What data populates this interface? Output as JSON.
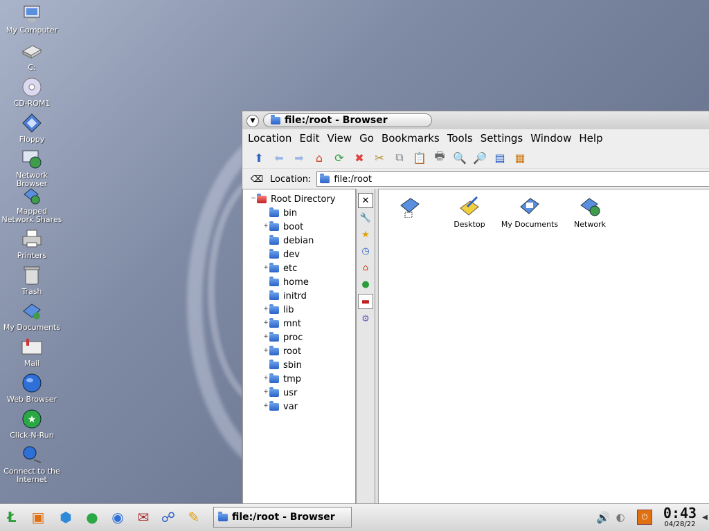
{
  "desktop": {
    "icons": [
      {
        "label": "My Computer",
        "icon": "computer-icon"
      },
      {
        "label": "C:",
        "icon": "drive-icon"
      },
      {
        "label": "CD-ROM1",
        "icon": "cdrom-icon"
      },
      {
        "label": "Floppy",
        "icon": "floppy-icon"
      },
      {
        "label": "Network Browser",
        "icon": "network-browser-icon"
      },
      {
        "label": "Mapped Network Shares",
        "icon": "network-shares-icon"
      },
      {
        "label": "Printers",
        "icon": "printer-icon"
      },
      {
        "label": "Trash",
        "icon": "trash-icon"
      },
      {
        "label": "My Documents",
        "icon": "documents-icon"
      },
      {
        "label": "Mail",
        "icon": "mail-icon"
      },
      {
        "label": "Web Browser",
        "icon": "globe-icon"
      },
      {
        "label": "Click-N-Run",
        "icon": "runner-icon"
      },
      {
        "label": "Connect to the Internet",
        "icon": "connect-icon"
      }
    ]
  },
  "window": {
    "title": "file:/root - Browser",
    "menu": [
      "Location",
      "Edit",
      "View",
      "Go",
      "Bookmarks",
      "Tools",
      "Settings",
      "Window",
      "Help"
    ],
    "location_label": "Location:",
    "location_value": "file:/root",
    "tree": {
      "root": "Root Directory",
      "items": [
        {
          "name": "bin",
          "expandable": false
        },
        {
          "name": "boot",
          "expandable": true
        },
        {
          "name": "debian",
          "expandable": false
        },
        {
          "name": "dev",
          "expandable": false
        },
        {
          "name": "etc",
          "expandable": true
        },
        {
          "name": "home",
          "expandable": false
        },
        {
          "name": "initrd",
          "expandable": false
        },
        {
          "name": "lib",
          "expandable": true
        },
        {
          "name": "mnt",
          "expandable": true
        },
        {
          "name": "proc",
          "expandable": true
        },
        {
          "name": "root",
          "expandable": true
        },
        {
          "name": "sbin",
          "expandable": false
        },
        {
          "name": "tmp",
          "expandable": true
        },
        {
          "name": "usr",
          "expandable": true
        },
        {
          "name": "var",
          "expandable": true
        }
      ]
    },
    "files": [
      {
        "label": "",
        "icon": "folder-shortcut-icon"
      },
      {
        "label": "Desktop",
        "icon": "desktop-folder-icon"
      },
      {
        "label": "My Documents",
        "icon": "documents-icon"
      },
      {
        "label": "Network",
        "icon": "network-icon"
      }
    ]
  },
  "taskbar": {
    "task_title": "file:/root - Browser",
    "clock_time": "0:43",
    "clock_date": "04/28/22"
  }
}
